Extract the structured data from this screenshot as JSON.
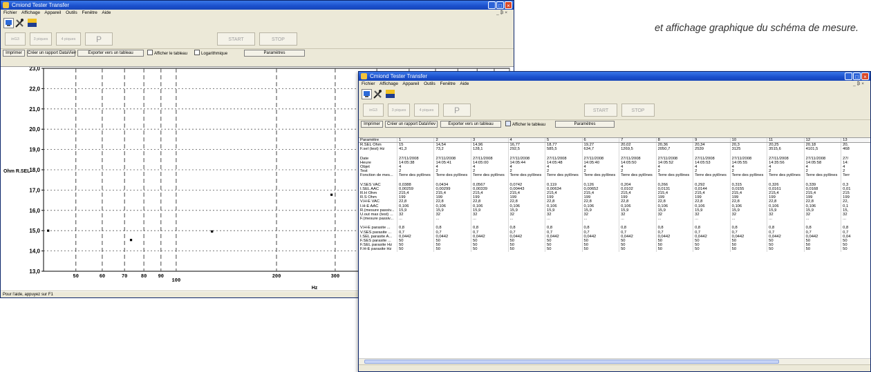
{
  "caption": "et affichage graphique du schéma de mesure.",
  "app_title": "Cmiond Tester Transfer",
  "menu": [
    "Fichier",
    "Affichage",
    "Appareil",
    "Outils",
    "Fenêtre",
    "Aide"
  ],
  "mdi_controls": "_ ₿ ×",
  "mode_buttons": [
    "inG3",
    "3 piques",
    "4 piques",
    "P"
  ],
  "start_label": "START",
  "stop_label": "STOP",
  "win1": {
    "controls": {
      "print": "Imprimer",
      "report": "Créer un rapport DataViev",
      "export": "Exporter vers un tableau",
      "show_table": "Afficher le tableau",
      "log": "Logarithmique",
      "params": "Paramètres"
    },
    "status": "Pour l'aide, appuyez sur F1"
  },
  "win2": {
    "controls": {
      "print": "Imprimer",
      "report": "Créer un rapport DataViev",
      "export": "Exporter vers un tableau",
      "show_table": "Afficher le tableau",
      "params": "Paramètres"
    }
  },
  "chart_data": {
    "type": "scatter",
    "ylabel": "Ohm R.SEL",
    "xlabel": "Hz",
    "x_scale": "log",
    "xlim": [
      40,
      1000
    ],
    "ylim": [
      13,
      23
    ],
    "y_ticks": [
      "23,0",
      "22,0",
      "21,0",
      "20,0",
      "19,0",
      "18,0",
      "17,0",
      "16,0",
      "15,0",
      "14,0",
      "13,0"
    ],
    "x_tick_labels": [
      {
        "x": 50,
        "label": "50"
      },
      {
        "x": 60,
        "label": "60"
      },
      {
        "x": 70,
        "label": "70"
      },
      {
        "x": 80,
        "label": "80"
      },
      {
        "x": 90,
        "label": "90"
      },
      {
        "x": 100,
        "label": "100"
      },
      {
        "x": 200,
        "label": "200"
      },
      {
        "x": 300,
        "label": "300"
      },
      {
        "x": 400,
        "label": "400"
      },
      {
        "x": 500,
        "label": "500"
      },
      {
        "x": 600,
        "label": "600"
      },
      {
        "x": 700,
        "label": "700"
      },
      {
        "x": 800,
        "label": "800"
      },
      {
        "x": 900,
        "label": "900"
      },
      {
        "x": 1000,
        "label": "1000"
      }
    ],
    "points": [
      {
        "x": 41.3,
        "y": 15.0
      },
      {
        "x": 73.2,
        "y": 14.54
      },
      {
        "x": 128.1,
        "y": 14.96
      },
      {
        "x": 292.5,
        "y": 16.77
      },
      {
        "x": 585.5,
        "y": 18.77
      },
      {
        "x": 634.7,
        "y": 19.27
      }
    ],
    "point_color": "#000000",
    "grid": true
  },
  "table": {
    "columns": [
      "Paramètre",
      "1",
      "2",
      "3",
      "4",
      "5",
      "6",
      "7",
      "8",
      "9",
      "10",
      "11",
      "12",
      "13"
    ],
    "groups": [
      [
        [
          "R.SEL  Ohm",
          "15",
          "14,54",
          "14,96",
          "16,77",
          "18,77",
          "19,27",
          "20,02",
          "20,36",
          "20,34",
          "20,3",
          "20,25",
          "20,18",
          "20,"
        ],
        [
          "F.sel (test)  Hz",
          "41,3",
          "73,2",
          "128,1",
          "292,5",
          "585,5",
          "634,7",
          "1269,5",
          "2050,7",
          "2539",
          "3125",
          "3515,6",
          "4101,5",
          "468"
        ]
      ],
      [
        [
          "Date",
          "27/11/2008",
          "27/11/2008",
          "27/11/2008",
          "27/11/2008",
          "27/11/2008",
          "27/11/2008",
          "27/11/2008",
          "27/11/2008",
          "27/11/2008",
          "27/11/2008",
          "27/11/2008",
          "27/11/2008",
          "27/"
        ],
        [
          "Heure",
          "14:05:38",
          "14:05:41",
          "14:05:00",
          "14:05:44",
          "14:05:48",
          "14:05:40",
          "14:05:50",
          "14:05:52",
          "14:05:53",
          "14:05:55",
          "14:35:56",
          "14:05:58",
          "14:"
        ],
        [
          "Objet",
          "4",
          "4",
          "4",
          "4",
          "4",
          "4",
          "4",
          "4",
          "4",
          "4",
          "4",
          "4",
          "4"
        ],
        [
          "Test",
          "2",
          "2",
          "2",
          "2",
          "2",
          "2",
          "2",
          "2",
          "2",
          "2",
          "2",
          "2",
          "2"
        ],
        [
          "Fonction de mes...",
          "Terre des pylônes",
          "Terre des pylônes",
          "Terre des pylônes",
          "Terre des pylônes",
          "Terre des pylônes",
          "Terre des pylônes",
          "Terre des pylônes",
          "Terre des pylônes",
          "Terre des pylônes",
          "Terre des pylônes",
          "Terre des pylônes",
          "Terre des pylônes",
          "Terr"
        ]
      ],
      [
        [
          "V.SES  VAC",
          "0,0388",
          "0,0434",
          "0,0567",
          "0,0742",
          "0,119",
          "0,126",
          "0,204",
          "0,266",
          "0,292",
          "0,315",
          "0,326",
          "0,339",
          "0,3"
        ],
        [
          "I.SEL  AAC",
          "0,00259",
          "0,00299",
          "0,00339",
          "0,00443",
          "0,00634",
          "0,00652",
          "0,0102",
          "0,0131",
          "0,0144",
          "0,0155",
          "0,0161",
          "0,0168",
          "0,01"
        ],
        [
          "R.H  Ohm",
          "215,4",
          "215,4",
          "215,4",
          "215,4",
          "215,4",
          "215,4",
          "215,4",
          "215,4",
          "215,4",
          "215,4",
          "215,4",
          "215,4",
          "215"
        ],
        [
          "R.S  Ohm",
          "199",
          "199",
          "199",
          "199",
          "199",
          "199",
          "199",
          "199",
          "199",
          "199",
          "199",
          "199",
          "199"
        ],
        [
          "V.H-E  VAC",
          "22,8",
          "22,8",
          "22,8",
          "22,8",
          "22,8",
          "22,8",
          "22,8",
          "22,8",
          "22,8",
          "22,8",
          "22,8",
          "22,8",
          "22,"
        ],
        [
          "I.H-E  AAC",
          "0,106",
          "0,106",
          "0,106",
          "0,106",
          "0,106",
          "0,106",
          "0,106",
          "0,106",
          "0,106",
          "0,106",
          "0,106",
          "0,106",
          "0,1"
        ],
        [
          "R.(mesure passiv...",
          "15,9",
          "15,9",
          "15,9",
          "15,9",
          "15,9",
          "15,9",
          "15,9",
          "15,9",
          "15,9",
          "15,9",
          "15,9",
          "15,9",
          "15,"
        ],
        [
          "U.out max (test)  ...",
          "32",
          "32",
          "32",
          "32",
          "32",
          "32",
          "32",
          "32",
          "32",
          "32",
          "32",
          "32",
          "32"
        ],
        [
          "F.(mesure passiv...",
          "...",
          "...",
          "...",
          "...",
          "...",
          "...",
          "...",
          "...",
          "...",
          "...",
          "...",
          "...",
          "..."
        ]
      ],
      [
        [
          "V.H-E parasite  ...",
          "0,8",
          "0,8",
          "0,8",
          "0,8",
          "0,8",
          "0,8",
          "0,8",
          "0,8",
          "0,8",
          "0,8",
          "0,8",
          "0,8",
          "0,8"
        ],
        [
          "V.SES parasite  ...",
          "0,7",
          "0,7",
          "0,7",
          "0,7",
          "0,7",
          "0,7",
          "0,7",
          "0,7",
          "0,7",
          "0,7",
          "0,7",
          "0,7",
          "0,7"
        ],
        [
          "I.SEL parasite  A...",
          "0,0442",
          "0,0442",
          "0,0442",
          "0,0442",
          "0,0442",
          "0,0442",
          "0,0442",
          "0,0442",
          "0,0442",
          "0,0442",
          "0,0442",
          "0,0442",
          "0,04"
        ],
        [
          "F.SES parasite  ...",
          "50",
          "50",
          "50",
          "50",
          "50",
          "50",
          "50",
          "50",
          "50",
          "50",
          "50",
          "50",
          "50"
        ],
        [
          "F.SEL parasite  Hz",
          "50",
          "50",
          "50",
          "50",
          "50",
          "50",
          "50",
          "50",
          "50",
          "50",
          "50",
          "50",
          "50"
        ],
        [
          "F.H-E parasite  Hz",
          "50",
          "50",
          "50",
          "50",
          "50",
          "50",
          "50",
          "50",
          "50",
          "50",
          "50",
          "50",
          "50"
        ]
      ]
    ]
  }
}
